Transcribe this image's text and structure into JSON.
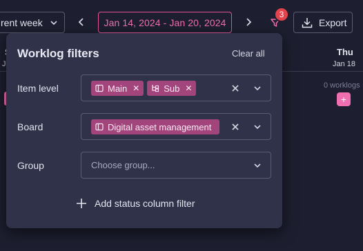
{
  "toolbar": {
    "week_select": "rent week",
    "date_range": "Jan 14, 2024 - Jan 20, 2024",
    "filter_count": "3",
    "export_label": "Export"
  },
  "calendar": {
    "left_day_fragment": "S",
    "left_date_fragment": "J",
    "day_name": "Thu",
    "day_date": "Jan 18",
    "worklogs_label": "0 worklogs",
    "add_label": "+"
  },
  "panel": {
    "title": "Worklog filters",
    "clear_all": "Clear all",
    "item_level": {
      "label": "Item level",
      "chips": [
        {
          "label": "Main",
          "icon": "board-icon"
        },
        {
          "label": "Sub",
          "icon": "subitem-icon"
        }
      ]
    },
    "board": {
      "label": "Board",
      "chips": [
        {
          "label": "Digital asset management",
          "icon": "board-icon"
        }
      ]
    },
    "group": {
      "label": "Group",
      "placeholder": "Choose group..."
    },
    "add_status_filter": "Add status column filter"
  },
  "colors": {
    "accent": "#e0559a",
    "chip": "#a3457d",
    "badge": "#e4434c",
    "panel": "#30324a",
    "background": "#1d1e2f"
  }
}
